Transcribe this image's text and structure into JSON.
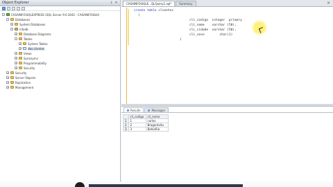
{
  "object_explorer": {
    "title": "Object Explorer",
    "pin_icon": "pin-icon",
    "close_icon": "close-icon",
    "tree": [
      {
        "label": "CASAINFO\\SQLEXPRESS (SQL Server 9.0.3042 - CASAINFO\\Dell)",
        "icon": "server-icon"
      },
      {
        "label": "Databases",
        "icon": "folder-icon"
      },
      {
        "label": "System Databases",
        "icon": "folder-icon"
      },
      {
        "label": "infodb",
        "icon": "db-icon"
      },
      {
        "label": "Database Diagrams",
        "icon": "folder-icon"
      },
      {
        "label": "Tables",
        "icon": "folder-icon"
      },
      {
        "label": "System Tables",
        "icon": "folder-icon"
      },
      {
        "label": "dbo.clientes",
        "icon": "table-icon"
      },
      {
        "label": "Views",
        "icon": "folder-icon"
      },
      {
        "label": "Synonyms",
        "icon": "folder-icon"
      },
      {
        "label": "Programmability",
        "icon": "folder-icon"
      },
      {
        "label": "Security",
        "icon": "folder-icon"
      },
      {
        "label": "Security",
        "icon": "folder-icon"
      },
      {
        "label": "Server Objects",
        "icon": "folder-icon"
      },
      {
        "label": "Replication",
        "icon": "folder-icon"
      },
      {
        "label": "Management",
        "icon": "folder-icon"
      }
    ]
  },
  "editor": {
    "tabs": [
      {
        "label": "CASAINFO\\SQLE...QLQuery1.sql*"
      },
      {
        "label": "Summary"
      }
    ],
    "code_lines": [
      {
        "kw": "create table",
        "rest": " clientes"
      },
      {
        "kw": "",
        "rest": "("
      },
      {
        "kw": "",
        "rest": "cli_codigo  integer  primary"
      },
      {
        "kw": "",
        "rest": "cli_nome    varchar (50),"
      },
      {
        "kw": "",
        "rest": "cli_cidade  varchar (50),"
      },
      {
        "kw": "",
        "rest": "cli_sexo        char(1)"
      },
      {
        "kw": "",
        "rest": ")"
      }
    ]
  },
  "results": {
    "tabs": [
      {
        "label": "Results"
      },
      {
        "label": "Messages"
      }
    ],
    "columns": [
      "cli_codigo",
      "cli_nome"
    ],
    "rows": [
      {
        "num": "1",
        "codigo": "1",
        "nome": "carlos"
      },
      {
        "num": "2",
        "codigo": "2",
        "nome": "Bragantvitu"
      },
      {
        "num": "3",
        "codigo": "3",
        "nome": "BahiaRio"
      }
    ]
  }
}
